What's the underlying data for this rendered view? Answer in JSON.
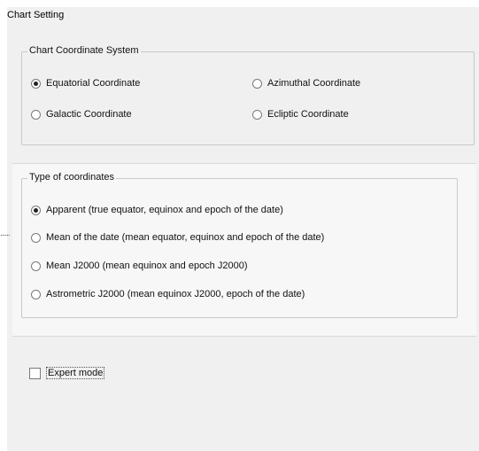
{
  "title": "Chart Setting",
  "coordinate_system": {
    "legend": "Chart Coordinate System",
    "options": [
      {
        "label": "Equatorial Coordinate",
        "checked": true
      },
      {
        "label": "Azimuthal Coordinate",
        "checked": false
      },
      {
        "label": "Galactic Coordinate",
        "checked": false
      },
      {
        "label": "Ecliptic Coordinate",
        "checked": false
      }
    ]
  },
  "coordinate_type": {
    "legend": "Type of coordinates",
    "options": [
      {
        "label": "Apparent (true equator, equinox and epoch of the date)",
        "checked": true
      },
      {
        "label": "Mean of the date (mean equator, equinox and epoch of the date)",
        "checked": false
      },
      {
        "label": "Mean J2000 (mean equinox and epoch J2000)",
        "checked": false
      },
      {
        "label": "Astrometric J2000 (mean equinox J2000, epoch of the date)",
        "checked": false
      }
    ]
  },
  "expert_mode": {
    "label": "Expert mode",
    "checked": false
  },
  "ellipsis": "......"
}
